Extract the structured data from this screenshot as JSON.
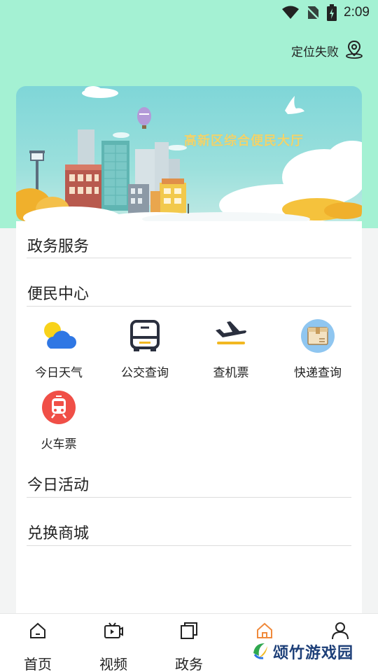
{
  "status_bar": {
    "time": "2:09"
  },
  "location": {
    "label": "定位失败"
  },
  "banner": {
    "title": "高新区综合便民大厅"
  },
  "sections": {
    "gov_service": "政务服务",
    "convenience": "便民中心",
    "today_activity": "今日活动",
    "exchange_mall": "兑换商城"
  },
  "services": [
    {
      "label": "今日天气",
      "icon": "weather-icon"
    },
    {
      "label": "公交查询",
      "icon": "bus-icon"
    },
    {
      "label": "查机票",
      "icon": "plane-icon"
    },
    {
      "label": "快递查询",
      "icon": "package-icon"
    },
    {
      "label": "火车票",
      "icon": "train-icon"
    }
  ],
  "bottom_nav": [
    {
      "label": "首页",
      "icon": "home-icon"
    },
    {
      "label": "视频",
      "icon": "video-icon"
    },
    {
      "label": "政务",
      "icon": "gov-icon"
    },
    {
      "label": "",
      "icon": "home-outline-icon",
      "active_color": "#f08a3c"
    },
    {
      "label": "",
      "icon": "user-icon"
    }
  ],
  "watermark": {
    "text": "颂竹游戏园"
  },
  "colors": {
    "header_bg": "#a4f1d3",
    "accent": "#f08a3c",
    "card_bg": "#ffffff"
  }
}
